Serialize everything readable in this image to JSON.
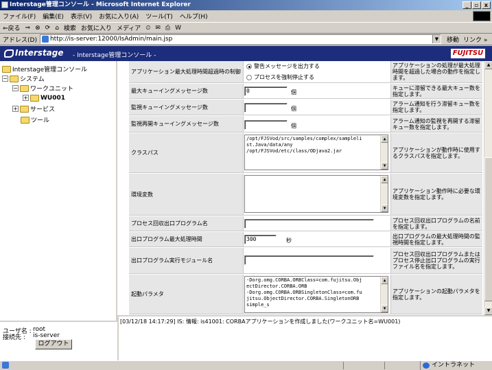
{
  "window": {
    "title": "Interstage管理コンソール - Microsoft Internet Explorer",
    "buttons": [
      "_",
      "▫",
      "x"
    ]
  },
  "menu": [
    "ファイル(F)",
    "編集(E)",
    "表示(V)",
    "お気に入り(A)",
    "ツール(T)",
    "ヘルプ(H)"
  ],
  "toolbar": {
    "back": "⇐戻る",
    "forward": "⇒",
    "stop": "⊗",
    "refresh": "⟳",
    "home": "⌂",
    "search": "検索",
    "favorites": "お気に入り",
    "media": "メディア",
    "history": "⏲",
    "mail": "✉",
    "print": "⎙",
    "edit": "W"
  },
  "address": {
    "label": "アドレス(D)",
    "url": "http://is-server:12000/IsAdmin/main.jsp",
    "go": "移動",
    "links": "リンク »"
  },
  "banner": {
    "product": "Interstage",
    "subtitle": "- Interstage管理コンソール -",
    "vendor": "FUJITSU"
  },
  "tree": {
    "root": "Interstage管理コンソール",
    "system": "システム",
    "workunit": "ワークユニット",
    "wu": "WU001",
    "service": "サービス",
    "tool": "ツール"
  },
  "form": {
    "r0": {
      "label": "アプリケーション最大処理時間超過時の制御",
      "radio1": "警告メッセージを出力する",
      "radio2": "プロセスを強制停止する",
      "desc": "アプリケーションの処理が最大処理時間を超過した場合の動作を指定します。"
    },
    "r1": {
      "label": "最大キューイングメッセージ数",
      "value": "0",
      "unit": "個",
      "desc": "キューに滞留できる最大キュー数を指定します。"
    },
    "r2": {
      "label": "監視キューイングメッセージ数",
      "value": "",
      "unit": "個",
      "desc": "アラーム通知を行う滞留キュー数を指定します。"
    },
    "r3": {
      "label": "監視再開キューイングメッセージ数",
      "value": "",
      "unit": "個",
      "desc": "アラーム通知の監視を再開する滞留キュー数を指定します。"
    },
    "r4": {
      "label": "クラスパス",
      "value": "/opt/FJSVod/src/samples/complex/sampleli\nst.Java/data/any\n/opt/FJSVod/etc/class/ODjava2.jar",
      "desc": "アプリケーションが動作時に使用するクラスパスを指定します。"
    },
    "r5": {
      "label": "環境変数",
      "value": "",
      "desc": "アプリケーション動作時に必要な環境変数を指定します。"
    },
    "r6": {
      "label": "プロセス回収出口プログラム名",
      "value": "",
      "desc": "プロセス回収出口プログラムの名前を指定します。"
    },
    "r7": {
      "label": "出口プログラム最大処理時間",
      "value": "300",
      "unit": "秒",
      "desc": "出口プログラムの最大処理時間の監視時間を指定します。"
    },
    "r8": {
      "label": "出口プログラム実行モジュール名",
      "value": "",
      "desc": "プロセス回収出口プログラムまたはプロセス停止出口プログラムの実行ファイル名を指定します。"
    },
    "r9": {
      "label": "起動パラメタ",
      "value": "-Dorg.omg.CORBA.ORBClass=com.fujitsu.Obj\nectDirector.CORBA.ORB\n-Dorg.omg.CORBA.ORBSingletonClass=com.fu\njitsu.ObjectDirector.CORBA.SingletonORB\nsimple_s",
      "desc": "アプリケーションの起動パラメタを指定します。"
    }
  },
  "user": {
    "user_label": "ユーザ名 :",
    "user": "root",
    "host_label": "接続先 :",
    "host": "is-server",
    "logout": "ログアウト"
  },
  "log": "[03/12/18 14:17:29] IS: 情報: is41001: CORBAアプリケーションを作成しました(ワークユニット名=WU001)",
  "status": {
    "zone": "イントラネット"
  }
}
